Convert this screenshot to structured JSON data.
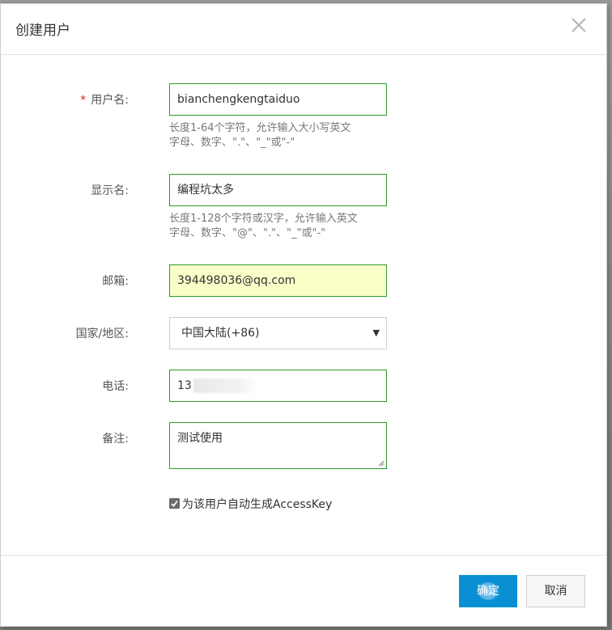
{
  "dialog": {
    "title": "创建用户",
    "close_icon": "close-icon"
  },
  "form": {
    "username": {
      "required_mark": "*",
      "label": "用户名:",
      "value": "bianchengkengtaiduo",
      "hint_line1": "长度1-64个字符，允许输入大小写英文",
      "hint_line2": "字母、数字、\".\"、\"_\"或\"-\""
    },
    "display_name": {
      "label": "显示名:",
      "value": "编程坑太多",
      "hint_line1": "长度1-128个字符或汉字，允许输入英文",
      "hint_line2": "字母、数字、\"@\"、\".\"、\"_\"或\"-\""
    },
    "email": {
      "label": "邮箱:",
      "value": "394498036@qq.com"
    },
    "region": {
      "label": "国家/地区:",
      "selected": "中国大陆(+86)"
    },
    "phone": {
      "label": "电话:",
      "value": "13"
    },
    "note": {
      "label": "备注:",
      "value": "测试使用"
    },
    "auto_accesskey": {
      "checked": true,
      "label": "为该用户自动生成AccessKey"
    }
  },
  "footer": {
    "confirm_label": "确定",
    "cancel_label": "取消"
  },
  "colors": {
    "primary": "#0a8fd4",
    "valid_border": "#2e9a2e",
    "required": "#e02020",
    "autofill": "#fafdc8"
  }
}
